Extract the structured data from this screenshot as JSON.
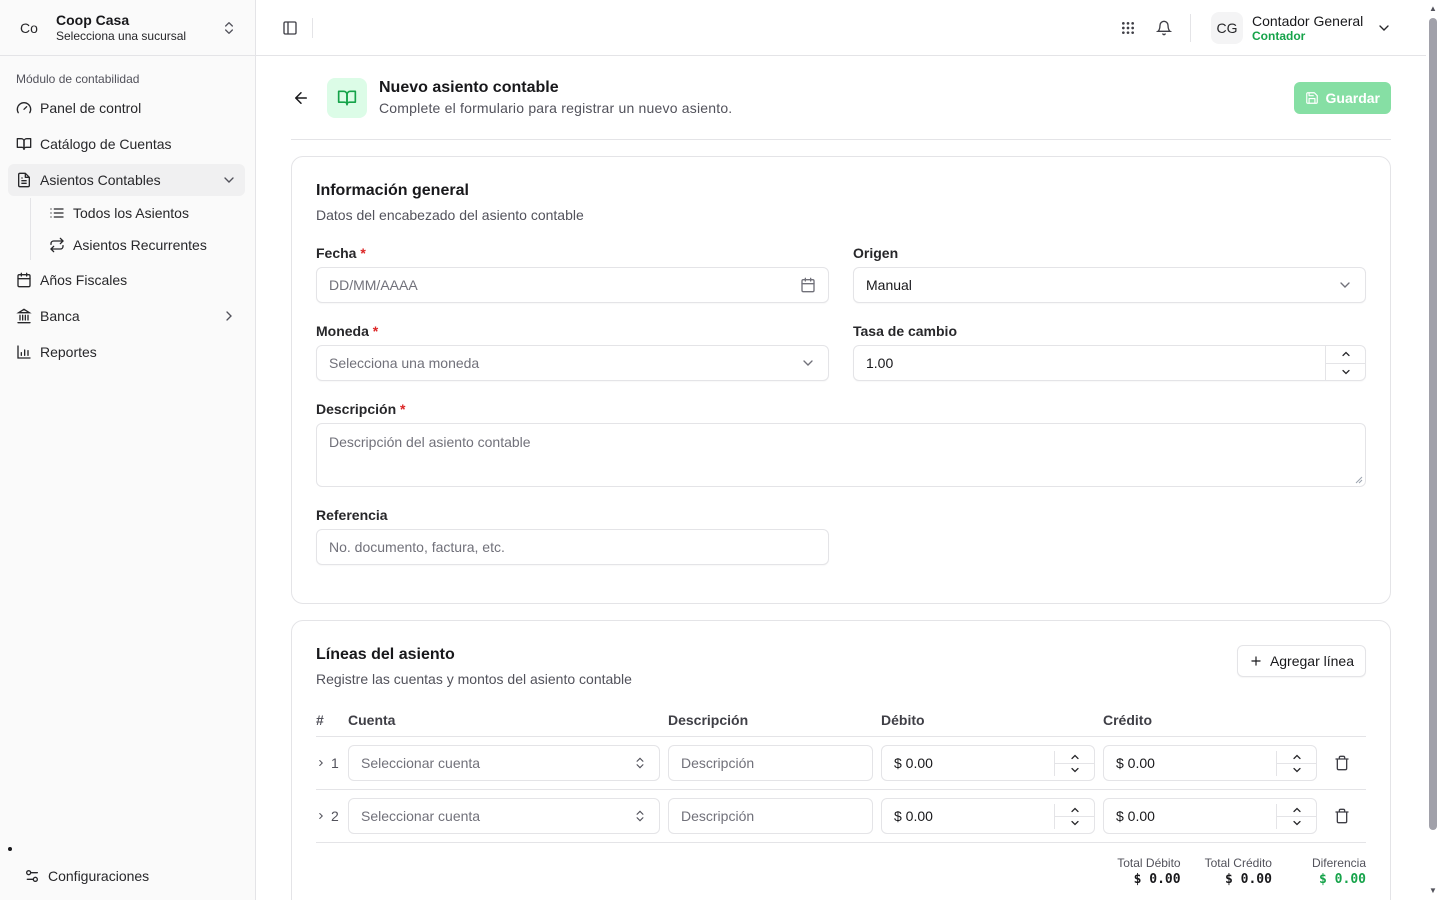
{
  "sidebar": {
    "org_initials": "Co",
    "org_name": "Coop Casa",
    "org_sub": "Selecciona una sucursal",
    "section_label": "Módulo de contabilidad",
    "items": [
      {
        "label": "Panel de control",
        "icon": "gauge-icon"
      },
      {
        "label": "Catálogo de Cuentas",
        "icon": "book-open-icon"
      },
      {
        "label": "Asientos Contables",
        "icon": "file-text-icon"
      },
      {
        "label": "Años Fiscales",
        "icon": "calendar-icon"
      },
      {
        "label": "Banca",
        "icon": "landmark-icon"
      },
      {
        "label": "Reportes",
        "icon": "bar-chart-icon"
      }
    ],
    "sub_items": [
      {
        "label": "Todos los Asientos",
        "icon": "list-icon"
      },
      {
        "label": "Asientos Recurrentes",
        "icon": "repeat-icon"
      }
    ],
    "settings_label": "Configuraciones"
  },
  "header": {
    "user_initials": "CG",
    "user_name": "Contador General",
    "user_role": "Contador"
  },
  "page": {
    "title": "Nuevo asiento contable",
    "subtitle": "Complete el formulario para registrar un nuevo asiento.",
    "save_label": "Guardar"
  },
  "general": {
    "title": "Información general",
    "subtitle": "Datos del encabezado del asiento contable",
    "fecha_label": "Fecha",
    "fecha_placeholder": "DD/MM/AAAA",
    "origen_label": "Origen",
    "origen_value": "Manual",
    "moneda_label": "Moneda",
    "moneda_placeholder": "Selecciona una moneda",
    "tasa_label": "Tasa de cambio",
    "tasa_value": "1.00",
    "descripcion_label": "Descripción",
    "descripcion_placeholder": "Descripción del asiento contable",
    "referencia_label": "Referencia",
    "referencia_placeholder": "No. documento, factura, etc.",
    "required_mark": "*"
  },
  "lines": {
    "title": "Líneas del asiento",
    "subtitle": "Registre las cuentas y montos del asiento contable",
    "add_label": "Agregar línea",
    "columns": {
      "num": "#",
      "cuenta": "Cuenta",
      "descripcion": "Descripción",
      "debito": "Débito",
      "credito": "Crédito"
    },
    "rows": [
      {
        "num": "1",
        "account_placeholder": "Seleccionar cuenta",
        "desc_placeholder": "Descripción",
        "debit": "$ 0.00",
        "credit": "$ 0.00"
      },
      {
        "num": "2",
        "account_placeholder": "Seleccionar cuenta",
        "desc_placeholder": "Descripción",
        "debit": "$ 0.00",
        "credit": "$ 0.00"
      }
    ],
    "totals": {
      "debit_label": "Total Débito",
      "debit_value": "$ 0.00",
      "credit_label": "Total Crédito",
      "credit_value": "$ 0.00",
      "diff_label": "Diferencia",
      "diff_value": "$ 0.00"
    }
  },
  "colors": {
    "accent": "#16a34a",
    "save_disabled": "#86dfa4",
    "required": "#dc2626"
  }
}
